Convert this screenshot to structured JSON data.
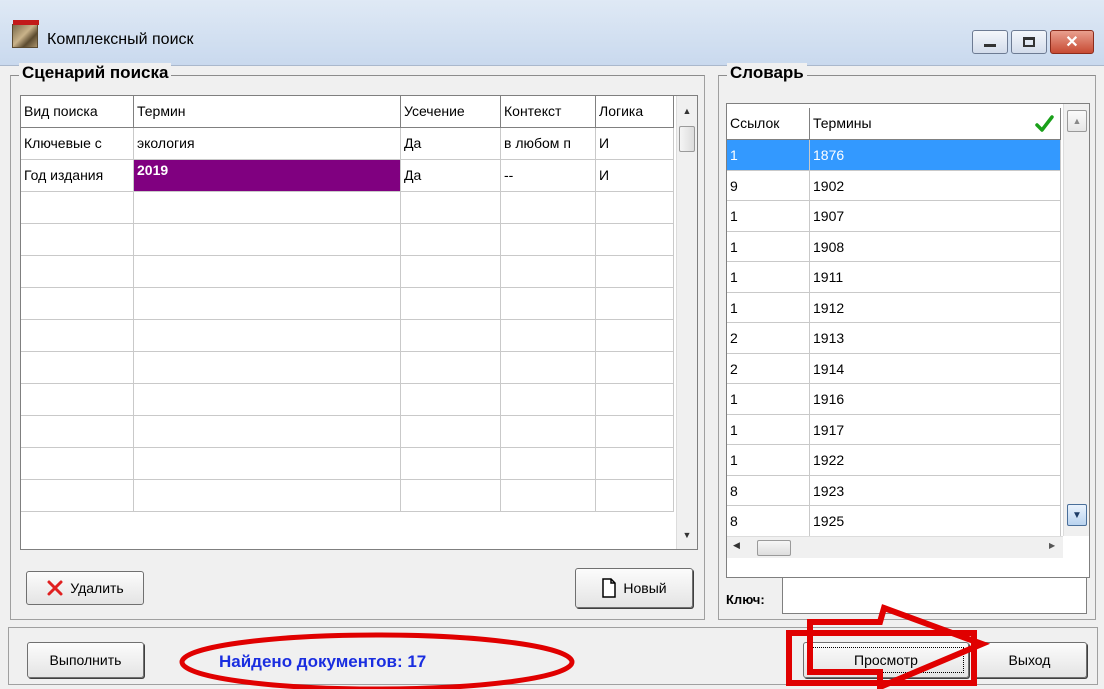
{
  "window": {
    "title": "Комплексный поиск"
  },
  "scenario": {
    "legend": "Сценарий поиска",
    "columns": [
      "Вид поиска",
      "Термин",
      "Усечение",
      "Контекст",
      "Логика"
    ],
    "rows": [
      [
        "Ключевые с",
        "экология",
        "Да",
        "в любом п",
        "И"
      ],
      [
        "Год издания",
        "2019",
        "Да",
        "--",
        "И"
      ]
    ],
    "empty_rows": 10,
    "delete_label": "Удалить",
    "new_label": "Новый"
  },
  "dictionary": {
    "legend": "Словарь",
    "columns": [
      "Ссылок",
      "Термины"
    ],
    "rows": [
      [
        "1",
        "1876"
      ],
      [
        "9",
        "1902"
      ],
      [
        "1",
        "1907"
      ],
      [
        "1",
        "1908"
      ],
      [
        "1",
        "1911"
      ],
      [
        "1",
        "1912"
      ],
      [
        "2",
        "1913"
      ],
      [
        "2",
        "1914"
      ],
      [
        "1",
        "1916"
      ],
      [
        "1",
        "1917"
      ],
      [
        "1",
        "1922"
      ],
      [
        "8",
        "1923"
      ],
      [
        "8",
        "1925"
      ]
    ],
    "key_label": "Ключ:",
    "key_value": ""
  },
  "footer": {
    "execute_label": "Выполнить",
    "found_text": "Найдено документов: 17",
    "view_label": "Просмотр",
    "exit_label": "Выход"
  },
  "colors": {
    "selected_term_bg": "#800080",
    "dictionary_selected_bg": "#3399ff",
    "found_text": "#1a2ee0",
    "annotation": "#e00000",
    "check": "#1aa01a"
  },
  "icons": {
    "delete": "red-x-icon",
    "new": "blank-document-icon",
    "confirm": "check-icon"
  }
}
